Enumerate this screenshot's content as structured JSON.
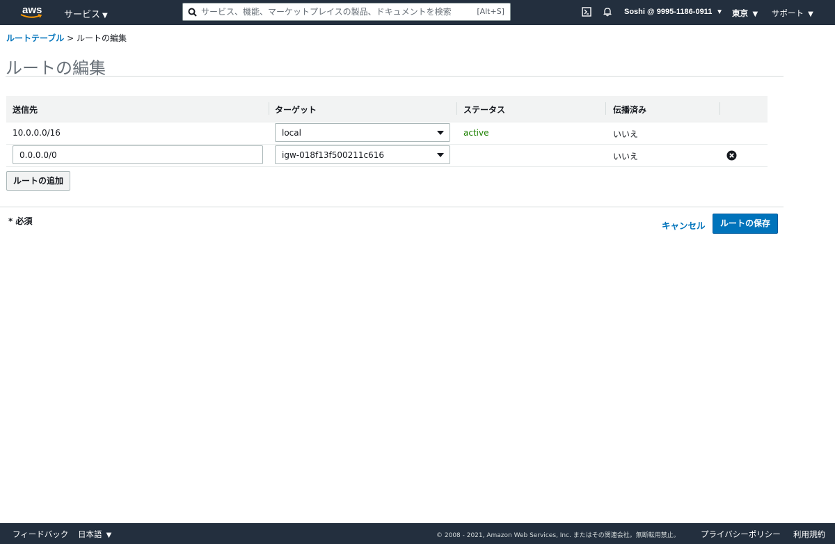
{
  "topnav": {
    "logo_text": "aws",
    "services_label": "サービス",
    "search_placeholder": "サービス、機能、マーケットプレイスの製品、ドキュメントを検索しま",
    "search_shortcut": "[Alt+S]",
    "account_label": "Soshi @ 9995-1186-0911",
    "region_label": "東京",
    "support_label": "サポート"
  },
  "breadcrumb": {
    "parent_label": "ルートテーブル",
    "separator": ">",
    "current_label": "ルートの編集"
  },
  "page_title": "ルートの編集",
  "table": {
    "columns": [
      "送信先",
      "ターゲット",
      "ステータス",
      "伝播済み"
    ],
    "rows": [
      {
        "destination": "10.0.0.0/16",
        "target": "local",
        "status": "active",
        "propagated": "いいえ"
      },
      {
        "destination": "0.0.0.0/0",
        "target": "igw-018f13f500211c616",
        "status": "",
        "propagated": "いいえ"
      }
    ]
  },
  "actions": {
    "add_route_label": "ルートの追加",
    "required_note": "* 必須",
    "cancel_label": "キャンセル",
    "save_label": "ルートの保存"
  },
  "footer": {
    "feedback_label": "フィードバック",
    "language_label": "日本語",
    "copyright": "© 2008 - 2021, Amazon Web Services, Inc. またはその関連会社。無断転用禁止。",
    "privacy_label": "プライバシーポリシー",
    "terms_label": "利用規約"
  },
  "colors": {
    "nav_bg": "#232f3e",
    "link": "#0073bb",
    "primary_button": "#0073bb",
    "status_active": "#1d8102",
    "logo_accent": "#ff9900"
  }
}
